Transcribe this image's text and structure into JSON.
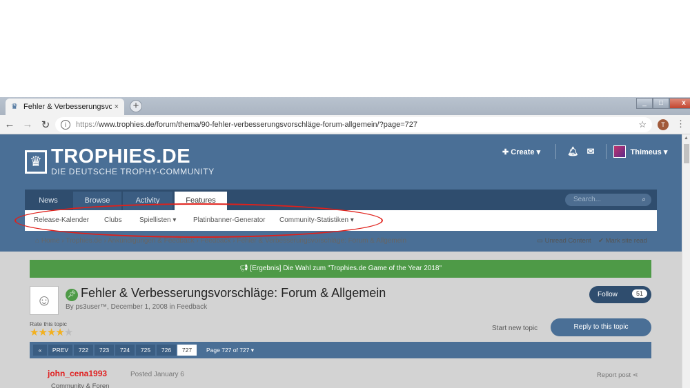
{
  "browser": {
    "tab_title": "Fehler & Verbesserungsvorschläg",
    "tab_close": "×",
    "new_tab": "+",
    "url_prefix": "https://",
    "url": "www.trophies.de/forum/thema/90-fehler-verbesserungsvorschläge-forum-allgemein/?page=727",
    "profile_initial": "T"
  },
  "site": {
    "logo_title": "TROPHIES.DE",
    "logo_subtitle": "DIE DEUTSCHE TROPHY-COMMUNITY",
    "create_label": "Create",
    "username": "Thimeus",
    "nav_tabs": [
      "News",
      "Browse",
      "Activity",
      "Features"
    ],
    "active_tab": "Features",
    "search_placeholder": "Search...",
    "subnav": [
      "Release-Kalender",
      "Clubs",
      "Spiellisten",
      "Platinbanner-Generator",
      "Community-Statistiken"
    ],
    "breadcrumb": [
      "Home",
      "Trophies.de",
      "Ankündigungen & Feedback",
      "Feedback",
      "Fehler & Verbesserungsvorschläge: Forum & Allgemein"
    ],
    "unread_content": "Unread Content",
    "mark_site_read": "Mark site read",
    "announcement": "[Ergebnis] Die Wahl zum \"Trophies.de Game of the Year 2018\""
  },
  "topic": {
    "title": "Fehler & Verbesserungsvorschläge: Forum & Allgemein",
    "meta": "By ps3user™, December 1, 2008 in Feedback",
    "follow_label": "Follow",
    "follow_count": "51",
    "rate_label": "Rate this topic",
    "rating": 4.5,
    "start_new_topic": "Start new topic",
    "reply_label": "Reply to this topic"
  },
  "pagination": {
    "first": "«",
    "prev": "PREV",
    "pages": [
      "722",
      "723",
      "724",
      "725",
      "726",
      "727"
    ],
    "current": "727",
    "info": "Page 727 of 727"
  },
  "post": {
    "author": "john_cena1993",
    "role": "Community & Foren",
    "date": "Posted January 6",
    "report": "Report post"
  },
  "colors": {
    "header_blue": "#4a6f96",
    "nav_dark": "#2f4d6e",
    "announce_green": "#4e9a47",
    "highlight_red": "#e0201a",
    "author_red": "#e02020"
  }
}
